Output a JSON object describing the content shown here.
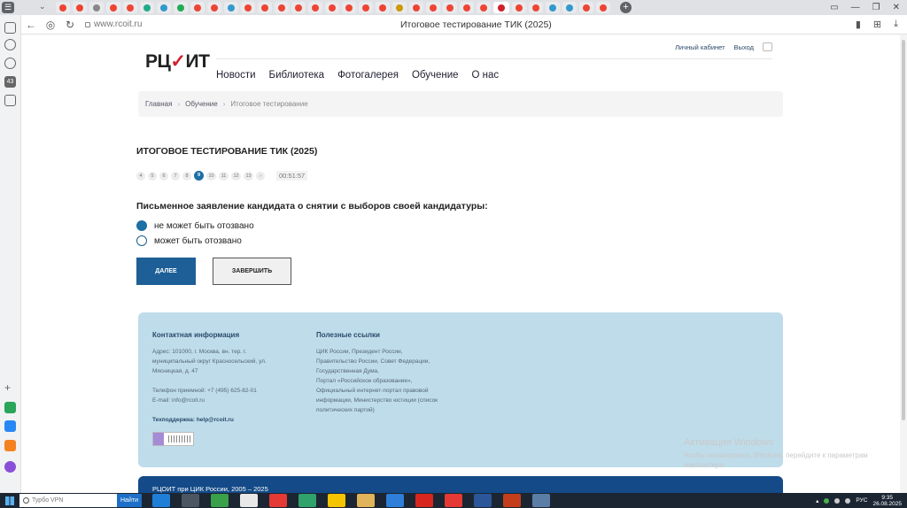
{
  "browser": {
    "tab_count_badge": "43",
    "url": "www.rcoit.ru",
    "page_title": "Итоговое тестирование ТИК (2025)"
  },
  "site": {
    "logo_text": "РЦОИТ",
    "top_links": {
      "cabinet": "Личный кабинет",
      "logout": "Выход"
    },
    "nav": [
      "Новости",
      "Библиотека",
      "Фотогалерея",
      "Обучение",
      "О нас"
    ],
    "breadcrumb": {
      "home": "Главная",
      "section": "Обучение",
      "current": "Итоговое тестирование"
    }
  },
  "test": {
    "title": "ИТОГОВОЕ ТЕСТИРОВАНИЕ ТИК (2025)",
    "pages": [
      "4",
      "5",
      "6",
      "7",
      "8",
      "9",
      "10",
      "11",
      "12",
      "13",
      "›"
    ],
    "current_page": "9",
    "timer": "00:51:57",
    "question": "Письменное заявление кандидата о снятии с выборов своей кандидатуры:",
    "options": [
      {
        "label": "не может быть отозвано",
        "selected": true
      },
      {
        "label": "может быть отозвано",
        "selected": false
      }
    ],
    "next_label": "ДАЛЕЕ",
    "finish_label": "ЗАВЕРШИТЬ"
  },
  "footer": {
    "contacts_title": "Контактная информация",
    "address_lines": [
      "Адрес: 101000, г. Москва, вн. тер. г.",
      "муниципальный округ Красносельский, ул.",
      "Мясницкая, д. 47"
    ],
    "phone": "Телефон приемной: +7 (495) 625-82-01",
    "email": "E-mail: info@rcoit.ru",
    "support_label": "Техподдержка:",
    "support_email": "help@rcoit.ru",
    "links_title": "Полезные ссылки",
    "links_lines": [
      "ЦИК России, Президент России,",
      "Правительство России, Совет Федерации,",
      "Государственная Дума,",
      "Портал «Российское образование»,",
      "Официальный интернет-портал правовой",
      "информации, Министерство юстиции (список",
      "политических партий)"
    ],
    "copyright": "РЦОИТ при ЦИК России, 2005 – 2025"
  },
  "watermark": {
    "title": "Активация Windows",
    "text": "Чтобы активировать Windows, перейдите к параметрам компьютера."
  },
  "taskbar": {
    "search_placeholder": "Турбо VPN",
    "search_button": "Найти",
    "lang": "РУС",
    "time": "9:35",
    "date": "26.08.2025"
  },
  "colors": {
    "accent": "#1d6fa5",
    "footer_bg": "#bfdcea",
    "footer_dark": "#134a87"
  }
}
